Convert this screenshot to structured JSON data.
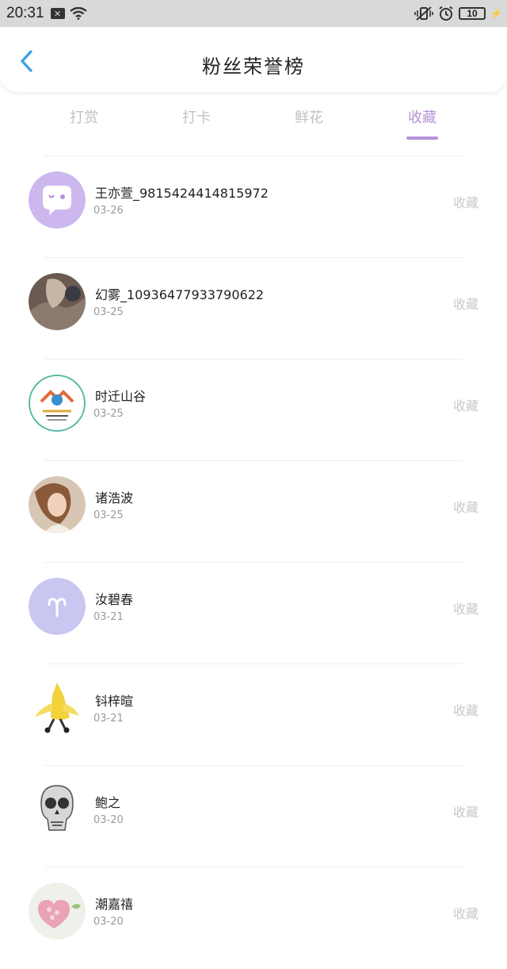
{
  "status_bar": {
    "time": "20:31",
    "x_badge": "✕",
    "battery": "10"
  },
  "header": {
    "title": "粉丝荣誉榜",
    "back_icon": "chevron-left-icon"
  },
  "tabs": [
    {
      "label": "打赏",
      "active": false
    },
    {
      "label": "打卡",
      "active": false
    },
    {
      "label": "鲜花",
      "active": false
    },
    {
      "label": "收藏",
      "active": true
    }
  ],
  "colors": {
    "accent": "#b493d8",
    "inactive_tab": "#c2c2c2",
    "muted_text": "#9a9a9a",
    "action_text": "#c8c8c8"
  },
  "fans": [
    {
      "name": "王亦萱_9815424414815972",
      "date": "03-26",
      "action": "收藏",
      "avatar": "chat-bubble-avatar"
    },
    {
      "name": "幻雾_10936477933790622",
      "date": "03-25",
      "action": "收藏",
      "avatar": "photo-avatar"
    },
    {
      "name": "时迁山谷",
      "date": "03-25",
      "action": "收藏",
      "avatar": "logo-avatar"
    },
    {
      "name": "诸浩波",
      "date": "03-25",
      "action": "收藏",
      "avatar": "photo-avatar"
    },
    {
      "name": "汝碧春",
      "date": "03-21",
      "action": "收藏",
      "avatar": "aries-avatar"
    },
    {
      "name": "钭梓暄",
      "date": "03-21",
      "action": "收藏",
      "avatar": "banana-avatar"
    },
    {
      "name": "鲍之",
      "date": "03-20",
      "action": "收藏",
      "avatar": "skull-avatar"
    },
    {
      "name": "潮嘉禧",
      "date": "03-20",
      "action": "收藏",
      "avatar": "cake-avatar"
    }
  ]
}
